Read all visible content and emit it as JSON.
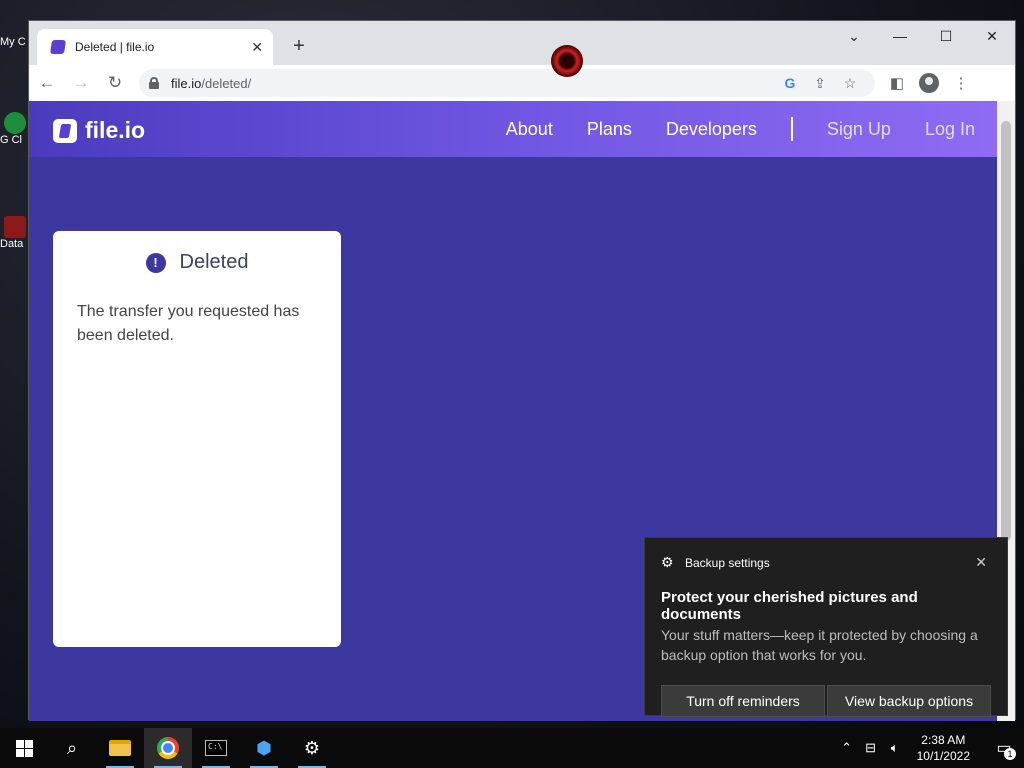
{
  "desktop": {
    "icons": [
      {
        "label": "My C"
      },
      {
        "label": "G Cl"
      },
      {
        "label": "Data"
      }
    ]
  },
  "browser": {
    "tab": {
      "title": "Deleted | file.io",
      "close_glyph": "✕"
    },
    "new_tab_glyph": "+",
    "window_controls": {
      "minimize": "—",
      "maximize": "☐",
      "close": "✕",
      "tabsearch": "⌄"
    },
    "url": {
      "host": "file.io",
      "path": "/deleted/"
    }
  },
  "site": {
    "logo_text": "file.io",
    "nav": {
      "about": "About",
      "plans": "Plans",
      "developers": "Developers",
      "signup": "Sign Up",
      "login": "Log In"
    },
    "card": {
      "icon_glyph": "!",
      "title": "Deleted",
      "message": "The transfer you requested has been deleted."
    }
  },
  "toast": {
    "app": "Backup settings",
    "title": "Protect your cherished pictures and documents",
    "text": "Your stuff matters—keep it protected by choosing a backup option that works for you.",
    "button_off": "Turn off reminders",
    "button_view": "View backup options",
    "close_glyph": "✕"
  },
  "taskbar": {
    "clock_time": "2:38 AM",
    "clock_date": "10/1/2022",
    "notif_count": "1"
  },
  "colors": {
    "page_bg": "#3d38a0",
    "header_gradient_start": "#4a3bbd",
    "header_gradient_end": "#8e6cf2"
  }
}
